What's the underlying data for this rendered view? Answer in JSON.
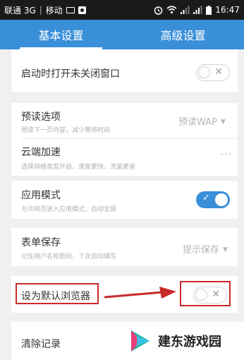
{
  "status_bar": {
    "carrier1": "联通 3G",
    "carrier2": "移动",
    "time": "16:47"
  },
  "tabs": [
    {
      "label": "基本设置",
      "active": true
    },
    {
      "label": "高级设置",
      "active": false
    }
  ],
  "settings": {
    "open_unclosed": {
      "title": "启动时打开未关闭窗口",
      "enabled": false
    },
    "preload": {
      "title": "预读选项",
      "subtitle": "预读下一页内容，减少等待时间",
      "value": "预读WAP"
    },
    "cloud": {
      "title": "云端加速",
      "subtitle": "选择网络类型开启，速度更快，流量更省"
    },
    "app_mode": {
      "title": "应用模式",
      "subtitle": "允许网页进入应用模式，自动全屏",
      "enabled": true
    },
    "form_save": {
      "title": "表单保存",
      "subtitle": "记住用户名和密码，下次自动填写",
      "value": "提示保存"
    },
    "default_browser": {
      "title": "设为默认浏览器",
      "enabled": false
    },
    "clear_records": {
      "title": "清除记录"
    }
  },
  "toggle_marks": {
    "off": "✕",
    "on": "✓"
  },
  "watermark": {
    "text": "建东游戏园"
  },
  "colors": {
    "accent": "#3a8fd9",
    "annotation": "#c92a2a",
    "status_bar": "#1a1a1a"
  }
}
